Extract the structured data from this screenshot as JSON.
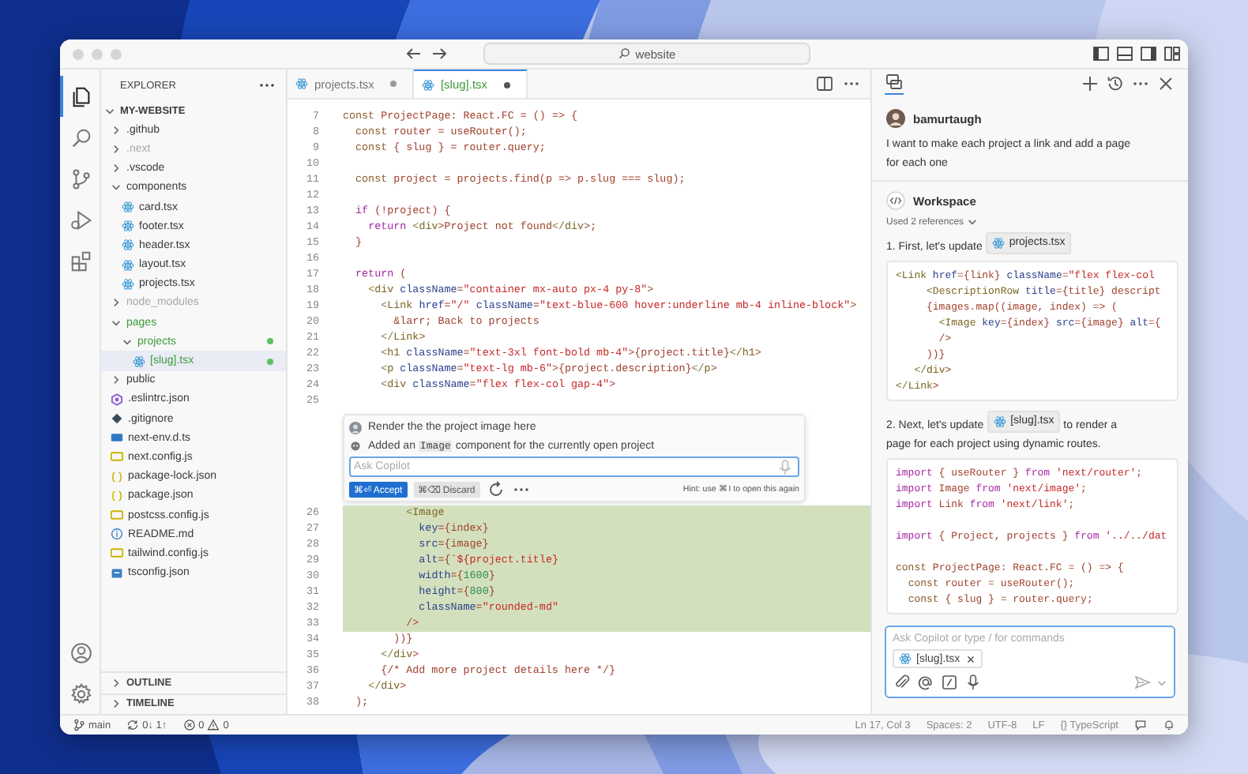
{
  "window": {
    "search": "website"
  },
  "activity_bar": {
    "top": [
      {
        "kind": "explorer",
        "selected": true
      },
      {
        "kind": "search",
        "selected": false
      },
      {
        "kind": "source-control",
        "selected": false
      },
      {
        "kind": "run",
        "selected": false
      },
      {
        "kind": "extensions",
        "selected": false
      }
    ],
    "bottom": [
      {
        "kind": "account"
      },
      {
        "kind": "settings"
      }
    ]
  },
  "explorer": {
    "title": "EXPLORER",
    "root": {
      "label": "MY-WEBSITE",
      "expanded": true,
      "children": [
        {
          "label": ".github",
          "kind": "folder",
          "expanded": false,
          "ignored": false,
          "untracked": false,
          "dot": false,
          "selected": false
        },
        {
          "label": ".next",
          "kind": "folder",
          "expanded": false,
          "ignored": true,
          "untracked": false,
          "dot": false,
          "selected": false
        },
        {
          "label": ".vscode",
          "kind": "folder",
          "expanded": false,
          "ignored": false,
          "untracked": false,
          "dot": false,
          "selected": false
        },
        {
          "label": "components",
          "kind": "folder",
          "expanded": true,
          "ignored": false,
          "untracked": false,
          "dot": false,
          "selected": false,
          "children": [
            {
              "label": "card.tsx",
              "kind": "react",
              "ignored": false,
              "untracked": false,
              "dot": false,
              "selected": false
            },
            {
              "label": "footer.tsx",
              "kind": "react",
              "ignored": false,
              "untracked": false,
              "dot": false,
              "selected": false
            },
            {
              "label": "header.tsx",
              "kind": "react",
              "ignored": false,
              "untracked": false,
              "dot": false,
              "selected": false
            },
            {
              "label": "layout.tsx",
              "kind": "react",
              "ignored": false,
              "untracked": false,
              "dot": false,
              "selected": false
            },
            {
              "label": "projects.tsx",
              "kind": "react",
              "ignored": false,
              "untracked": false,
              "dot": false,
              "selected": false
            }
          ]
        },
        {
          "label": "node_modules",
          "kind": "folder",
          "expanded": false,
          "ignored": true,
          "untracked": false,
          "dot": false,
          "selected": false
        },
        {
          "label": "pages",
          "kind": "folder",
          "expanded": true,
          "ignored": false,
          "untracked": true,
          "dot": false,
          "selected": false,
          "children": [
            {
              "label": "projects",
              "kind": "folder",
              "expanded": true,
              "ignored": false,
              "untracked": true,
              "dot": true,
              "selected": false,
              "children": [
                {
                  "label": "[slug].tsx",
                  "kind": "react",
                  "ignored": false,
                  "untracked": true,
                  "dot": true,
                  "selected": true
                }
              ]
            }
          ]
        },
        {
          "label": "public",
          "kind": "folder",
          "expanded": false,
          "ignored": false,
          "untracked": false,
          "dot": false,
          "selected": false
        },
        {
          "label": ".eslintrc.json",
          "kind": "eslint",
          "ignored": false,
          "untracked": false,
          "dot": false,
          "selected": false
        },
        {
          "label": ".gitignore",
          "kind": "git",
          "ignored": false,
          "untracked": false,
          "dot": false,
          "selected": false
        },
        {
          "label": "next-env.d.ts",
          "kind": "ts",
          "ignored": false,
          "untracked": false,
          "dot": false,
          "selected": false
        },
        {
          "label": "next.config.js",
          "kind": "js",
          "ignored": false,
          "untracked": false,
          "dot": false,
          "selected": false
        },
        {
          "label": "package-lock.json",
          "kind": "json",
          "ignored": false,
          "untracked": false,
          "dot": false,
          "selected": false
        },
        {
          "label": "package.json",
          "kind": "json",
          "ignored": false,
          "untracked": false,
          "dot": false,
          "selected": false
        },
        {
          "label": "postcss.config.js",
          "kind": "js",
          "ignored": false,
          "untracked": false,
          "dot": false,
          "selected": false
        },
        {
          "label": "README.md",
          "kind": "info",
          "ignored": false,
          "untracked": false,
          "dot": false,
          "selected": false
        },
        {
          "label": "tailwind.config.js",
          "kind": "js",
          "ignored": false,
          "untracked": false,
          "dot": false,
          "selected": false
        },
        {
          "label": "tsconfig.json",
          "kind": "tsconfig",
          "ignored": false,
          "untracked": false,
          "dot": false,
          "selected": false
        }
      ]
    },
    "sections": [
      {
        "label": "OUTLINE",
        "expanded": false
      },
      {
        "label": "TIMELINE",
        "expanded": false
      }
    ]
  },
  "tabs": [
    {
      "label": "projects.tsx",
      "selected": false,
      "modified": true,
      "untracked": false
    },
    {
      "label": "[slug].tsx",
      "selected": true,
      "modified": true,
      "untracked": true
    }
  ],
  "editor": {
    "lines_before": [
      {
        "num": "7",
        "code": "const ProjectPage: React.FC = () => {"
      },
      {
        "num": "8",
        "code": "  const router = useRouter();"
      },
      {
        "num": "9",
        "code": "  const { slug } = router.query;"
      },
      {
        "num": "10"
      },
      {
        "num": "11",
        "code": "  const project = projects.find(p => p.slug === slug);"
      },
      {
        "num": "12"
      },
      {
        "num": "13",
        "code": "  if (!project) {"
      },
      {
        "num": "14",
        "code": "    return <div>Project not found</div>;"
      },
      {
        "num": "15",
        "code": "  }"
      },
      {
        "num": "16"
      },
      {
        "num": "17",
        "code": "  return ("
      },
      {
        "num": "18",
        "code": "    <div className=\"container mx-auto px-4 py-8\">"
      },
      {
        "num": "19",
        "code": "      <Link href=\"/\" className=\"text-blue-600 hover:underline mb-4 inline-block\">"
      },
      {
        "num": "20",
        "code": "        &larr; Back to projects"
      },
      {
        "num": "21",
        "code": "      </Link>"
      },
      {
        "num": "22",
        "code": "      <h1 className=\"text-3xl font-bold mb-4\">{project.title}</h1>"
      },
      {
        "num": "23",
        "code": "      <p className=\"text-lg mb-6\">{project.description}</p>"
      },
      {
        "num": "24",
        "code": "      <div className=\"flex flex-col gap-4\">"
      },
      {
        "num": "25"
      }
    ],
    "inline_chat": {
      "request": "Render the the project image here",
      "reply_prefix": "Added an ",
      "reply_code": "Image",
      "reply_suffix": " component for the currently open project",
      "placeholder": "Ask Copilot",
      "accept": "⌘⏎ Accept",
      "discard": "⌘⌫ Discard",
      "hint": "Hint: use ⌘ I to open this again"
    },
    "lines_after": [
      {
        "num": "26",
        "code": "          <Image",
        "added": true
      },
      {
        "num": "27",
        "code": "            key={index}",
        "added": true
      },
      {
        "num": "28",
        "code": "            src={image}",
        "added": true
      },
      {
        "num": "29",
        "code": "            alt={`${project.title}",
        "added": true
      },
      {
        "num": "30",
        "code": "            width={1600}",
        "added": true
      },
      {
        "num": "31",
        "code": "            height={800}",
        "added": true
      },
      {
        "num": "32",
        "code": "            className=\"rounded-md\"",
        "added": true
      },
      {
        "num": "33",
        "code": "          />",
        "added": true
      },
      {
        "num": "34",
        "code": "        ))}",
        "added": false
      },
      {
        "num": "35",
        "code": "      </div>",
        "added": false
      },
      {
        "num": "36",
        "code": "      {/* Add more project details here */}",
        "added": false
      },
      {
        "num": "37",
        "code": "    </div>",
        "added": false
      },
      {
        "num": "38",
        "code": "  );",
        "added": false
      }
    ]
  },
  "chat": {
    "user": {
      "name": "bamurtaugh",
      "message": "I want to make each project a link and add a page for each one"
    },
    "response": {
      "agent": "Workspace",
      "references": "Used 2 references",
      "steps": [
        {
          "before": "1. First, let's update ",
          "file": "projects.tsx",
          "code": [
            [
              "<Link href={link} className=\"flex flex-col",
              "     <DescriptionRow title={title} descript",
              "     {images.map((image, index) => (",
              "       <Image key={index} src={image} alt={",
              "       />",
              "     ))}",
              "   </div>",
              "</Link>"
            ]
          ]
        },
        {
          "before": "2. Next, let's update ",
          "file": "[slug].tsx",
          "after": " to render a page for each project using dynamic routes.",
          "code": [
            [
              "import { useRouter } from 'next/router';",
              "import Image from 'next/image';",
              "import Link from 'next/link';"
            ],
            [
              "import { Project, projects } from '../../dat"
            ],
            [
              "const ProjectPage: React.FC = () => {",
              "  const router = useRouter();",
              "  const { slug } = router.query;"
            ]
          ]
        }
      ]
    },
    "input": {
      "placeholder": "Ask Copilot or type / for commands",
      "attachment": "[slug].tsx"
    }
  },
  "status_bar": {
    "branch": "main",
    "sync": "0↓ 1↑",
    "errors": "0",
    "warnings": "0",
    "right": [
      "Ln 17, Col 3",
      "Spaces: 2",
      "UTF-8",
      "LF",
      "{} TypeScript"
    ]
  }
}
